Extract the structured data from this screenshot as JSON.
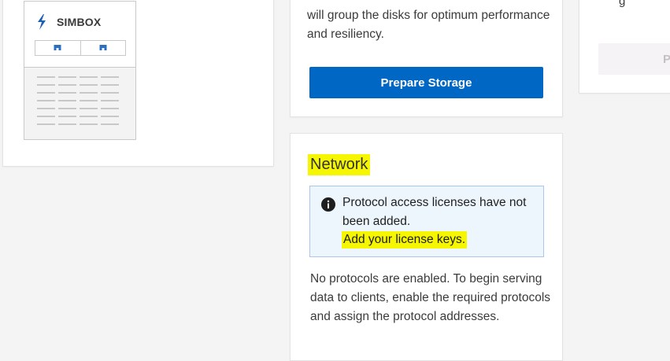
{
  "colors": {
    "page_bg": "#f4f4f4",
    "card_bg": "#ffffff",
    "primary": "#0067c5",
    "highlight": "#f6f600",
    "alert_bg": "#edf5fd",
    "alert_border": "#a9c7ea"
  },
  "simbox": {
    "title": "SIMBOX",
    "icon": "lightning-bolt-icon",
    "node_icon": "node-icon"
  },
  "storage": {
    "description": "will group the disks for optimum performance and resiliency.",
    "button_label": "Prepare Storage"
  },
  "right_card": {
    "text_fragment": "g",
    "button_label": "P"
  },
  "network": {
    "title": "Network",
    "alert": {
      "icon": "info-icon",
      "message": "Protocol access licenses have not been added.",
      "link_text": "Add your license keys."
    },
    "description": "No protocols are enabled. To begin serving data to clients, enable the required protocols and assign the protocol addresses."
  }
}
